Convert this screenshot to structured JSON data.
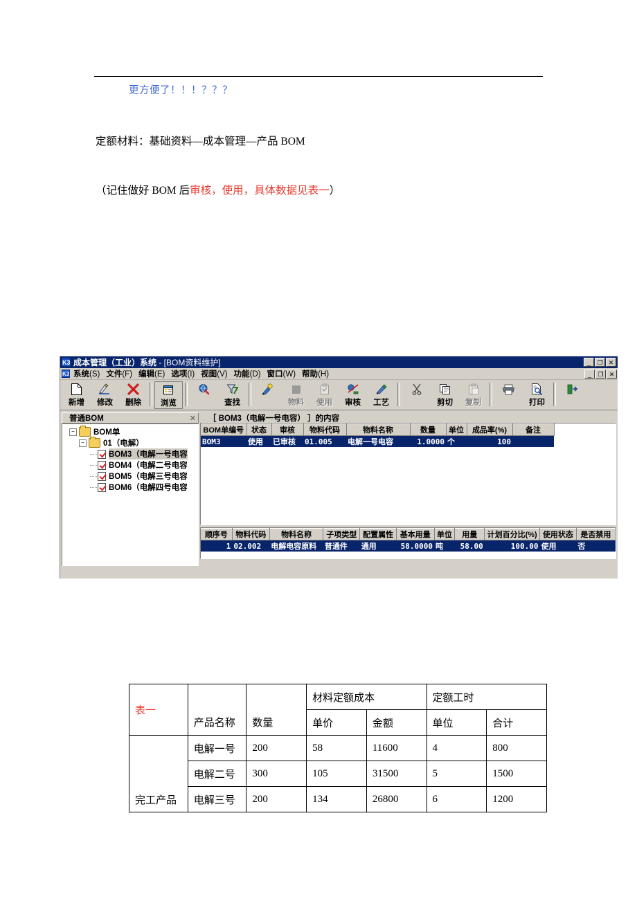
{
  "document": {
    "note_blue": "更方便了！！！？？？",
    "line_material": "定额材料：基础资料—成本管理—产品 BOM",
    "line_remark_pre": "（记住做好 BOM 后",
    "line_remark_red": "审核，使用，具体数据见表一",
    "line_remark_post": "）"
  },
  "app": {
    "titlebar": {
      "logo": "K3",
      "app_name": "成本管理（工业）系统",
      "doc_name": " - [BOM资料维护]",
      "minimize": "_",
      "restore": "❐",
      "close": "✕"
    },
    "menu": [
      {
        "label": "系统",
        "accel": "(S)"
      },
      {
        "label": "文件",
        "accel": "(F)"
      },
      {
        "label": "编辑",
        "accel": "(E)"
      },
      {
        "label": "选项",
        "accel": "(I)"
      },
      {
        "label": "视图",
        "accel": "(V)"
      },
      {
        "label": "功能",
        "accel": "(D)"
      },
      {
        "label": "窗口",
        "accel": "(W)"
      },
      {
        "label": "帮助",
        "accel": "(H)"
      }
    ],
    "toolbar": [
      {
        "label": "新增",
        "icon": "new-page-icon",
        "state": "enabled"
      },
      {
        "label": "修改",
        "icon": "edit-pencil-icon",
        "state": "enabled"
      },
      {
        "label": "删除",
        "icon": "delete-x-icon",
        "state": "enabled"
      },
      {
        "sep": true
      },
      {
        "label": "浏览",
        "icon": "browse-icon",
        "state": "pressed"
      },
      {
        "sep": true
      },
      {
        "label": "查找",
        "icon": "find-globe-icon",
        "state": "enabled"
      },
      {
        "label": "过滤",
        "icon": "filter-funnel-icon",
        "state": "enabled"
      },
      {
        "sep": true
      },
      {
        "label": "物料",
        "icon": "material-icon",
        "state": "enabled"
      },
      {
        "label": "使用",
        "icon": "use-icon",
        "state": "disabled"
      },
      {
        "label": "审核",
        "icon": "audit-icon",
        "state": "disabled"
      },
      {
        "label": "工艺",
        "icon": "process-icon",
        "state": "enabled"
      },
      {
        "label": "替代",
        "icon": "substitute-icon",
        "state": "enabled"
      },
      {
        "sep": true
      },
      {
        "label": "剪切",
        "icon": "scissors-icon",
        "state": "enabled"
      },
      {
        "label": "复制",
        "icon": "copy-icon",
        "state": "enabled"
      },
      {
        "label": "粘贴",
        "icon": "paste-icon",
        "state": "disabled"
      },
      {
        "sep": true
      },
      {
        "label": "打印",
        "icon": "printer-icon",
        "state": "enabled"
      },
      {
        "label": "预览",
        "icon": "preview-icon",
        "state": "enabled"
      },
      {
        "sep": true
      },
      {
        "label": "退出",
        "icon": "exit-door-icon",
        "state": "enabled"
      }
    ],
    "tree": {
      "title": "普通BOM",
      "close": "✕",
      "root": "BOM单",
      "group": "01（电解）",
      "items": [
        "BOM3（电解一号电容",
        "BOM4（电解二号电容",
        "BOM5（电解三号电容",
        "BOM6（电解四号电容"
      ]
    },
    "content_caption": "［ BOM3（电解一号电容） ］的内容",
    "master_grid": {
      "headers": [
        "BOM单编号",
        "状态",
        "审核",
        "物料代码",
        "物料名称",
        "数量",
        "单位",
        "成品率(%)",
        "备注"
      ],
      "row": [
        "BOM3",
        "使用",
        "已审核",
        "01.005",
        "电解一号电容",
        "1.0000",
        "个",
        "100",
        ""
      ]
    },
    "detail_grid": {
      "headers": [
        "顺序号",
        "物料代码",
        "物料名称",
        "子项类型",
        "配置属性",
        "基本用量",
        "单位",
        "用量",
        "计划百分比(%)",
        "使用状态",
        "是否禁用"
      ],
      "row": [
        "1",
        "02.002",
        "电解电容原料",
        "普通件",
        "通用",
        "58.0000",
        "吨",
        "58.00",
        "100.00",
        "使用",
        "否"
      ]
    }
  },
  "sheet": {
    "label": "表一",
    "group_material": "材料定额成本",
    "group_hours": "定额工时",
    "headers": [
      "产品名称",
      "数量",
      "单价",
      "金额",
      "单位",
      "合计"
    ],
    "row_group_label": "完工产品",
    "rows": [
      {
        "name": "电解一号",
        "qty": "200",
        "price": "58",
        "amount": "11600",
        "unit": "4",
        "total": "800"
      },
      {
        "name": "电解二号",
        "qty": "300",
        "price": "105",
        "amount": "31500",
        "unit": "5",
        "total": "1500"
      },
      {
        "name": "电解三号",
        "qty": "200",
        "price": "134",
        "amount": "26800",
        "unit": "6",
        "total": "1200"
      }
    ]
  }
}
